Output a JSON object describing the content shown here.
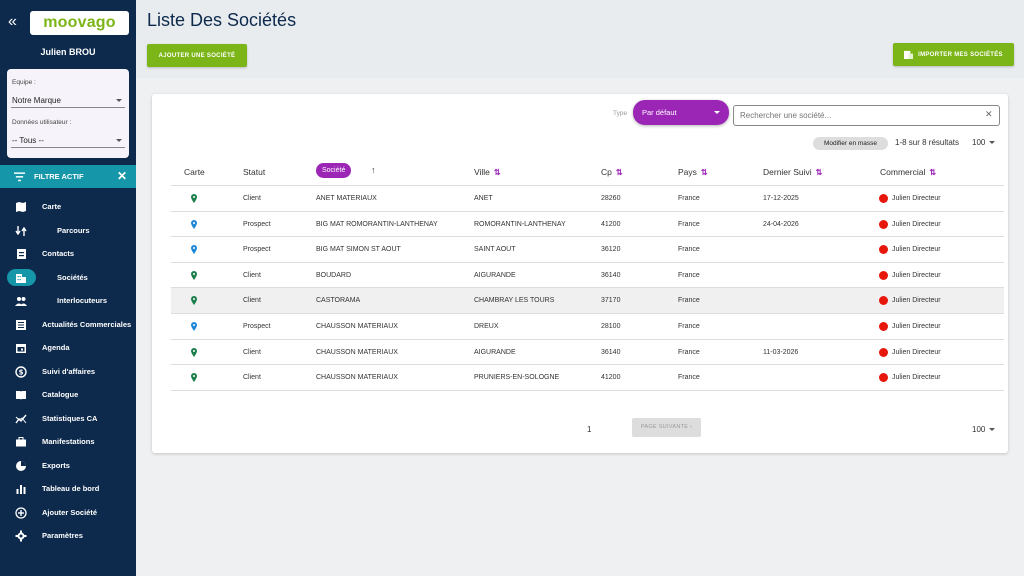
{
  "sidebar": {
    "logo_text": "moovago",
    "user_name": "Julien BROU",
    "team_label": "Equipe :",
    "team_value": "Notre Marque",
    "user_data_label": "Données utilisateur :",
    "user_data_value": "-- Tous --",
    "filter_active_label": "FILTRE ACTIF",
    "items": [
      {
        "label": "Carte",
        "icon": "map-icon",
        "sub": false
      },
      {
        "label": "Parcours",
        "icon": "route-icon",
        "sub": true
      },
      {
        "label": "Contacts",
        "icon": "contacts-icon",
        "sub": false
      },
      {
        "label": "Sociétés",
        "icon": "building-icon",
        "sub": true,
        "active": true
      },
      {
        "label": "Interlocuteurs",
        "icon": "people-icon",
        "sub": true
      },
      {
        "label": "Actualités Commerciales",
        "icon": "news-icon",
        "sub": false
      },
      {
        "label": "Agenda",
        "icon": "calendar-icon",
        "sub": false
      },
      {
        "label": "Suivi d'affaires",
        "icon": "money-icon",
        "sub": false
      },
      {
        "label": "Catalogue",
        "icon": "book-icon",
        "sub": false
      },
      {
        "label": "Statistiques CA",
        "icon": "stats-icon",
        "sub": false
      },
      {
        "label": "Manifestations",
        "icon": "briefcase-icon",
        "sub": false
      },
      {
        "label": "Exports",
        "icon": "pie-icon",
        "sub": false
      },
      {
        "label": "Tableau de bord",
        "icon": "bar-chart-icon",
        "sub": false
      },
      {
        "label": "Ajouter Société",
        "icon": "add-circle-icon",
        "sub": false
      },
      {
        "label": "Paramètres",
        "icon": "gear-icon",
        "sub": false
      }
    ]
  },
  "header": {
    "title": "Liste Des Sociétés",
    "add_button": "AJOUTER UNE SOCIÉTÉ",
    "import_button": "IMPORTER MES SOCIÉTÉS"
  },
  "toolbar": {
    "type_label": "Type",
    "type_value": "Par défaut",
    "search_placeholder": "Rechercher une société...",
    "mass_edit": "Modifier en masse",
    "results": "1-8 sur 8 résultats",
    "per_page": "100"
  },
  "table": {
    "columns": [
      "Carte",
      "Statut",
      "Société",
      "Ville",
      "Cp",
      "Pays",
      "Dernier Suivi",
      "Commercial"
    ],
    "rows": [
      {
        "pin": "green",
        "statut": "Client",
        "societe": "ANET MATERIAUX",
        "ville": "ANET",
        "cp": "28260",
        "pays": "France",
        "suivi": "17-12-2025",
        "commercial": "Julien Directeur"
      },
      {
        "pin": "blue",
        "statut": "Prospect",
        "societe": "BIG MAT ROMORANTIN-LANTHENAY",
        "ville": "ROMORANTIN-LANTHENAY",
        "cp": "41200",
        "pays": "France",
        "suivi": "24-04-2026",
        "commercial": "Julien Directeur"
      },
      {
        "pin": "blue",
        "statut": "Prospect",
        "societe": "BIG MAT SIMON ST AOUT",
        "ville": "SAINT AOUT",
        "cp": "36120",
        "pays": "France",
        "suivi": "",
        "commercial": "Julien Directeur"
      },
      {
        "pin": "green",
        "statut": "Client",
        "societe": "BOUDARD",
        "ville": "AIGURANDE",
        "cp": "36140",
        "pays": "France",
        "suivi": "",
        "commercial": "Julien Directeur"
      },
      {
        "pin": "green",
        "statut": "Client",
        "societe": "CASTORAMA",
        "ville": "CHAMBRAY LES TOURS",
        "cp": "37170",
        "pays": "France",
        "suivi": "",
        "commercial": "Julien Directeur"
      },
      {
        "pin": "blue",
        "statut": "Prospect",
        "societe": "CHAUSSON MATERIAUX",
        "ville": "DREUX",
        "cp": "28100",
        "pays": "France",
        "suivi": "",
        "commercial": "Julien Directeur"
      },
      {
        "pin": "green",
        "statut": "Client",
        "societe": "CHAUSSON MATERIAUX",
        "ville": "AIGURANDE",
        "cp": "36140",
        "pays": "France",
        "suivi": "11-03-2026",
        "commercial": "Julien Directeur"
      },
      {
        "pin": "green",
        "statut": "Client",
        "societe": "CHAUSSON MATERIAUX",
        "ville": "PRUNIERS-EN-SOLOGNE",
        "cp": "41200",
        "pays": "France",
        "suivi": "",
        "commercial": "Julien Directeur"
      }
    ]
  },
  "pagination": {
    "page": "1",
    "next": "PAGE SUIVANTE",
    "per_page": "100"
  },
  "colors": {
    "sidebar": "#0d2a4c",
    "accent_teal": "#1596a9",
    "green": "#7cb518",
    "purple": "#9b26b6",
    "red": "#e8170c",
    "pin_green": "#1a7f4b",
    "pin_blue": "#1e88d6"
  }
}
